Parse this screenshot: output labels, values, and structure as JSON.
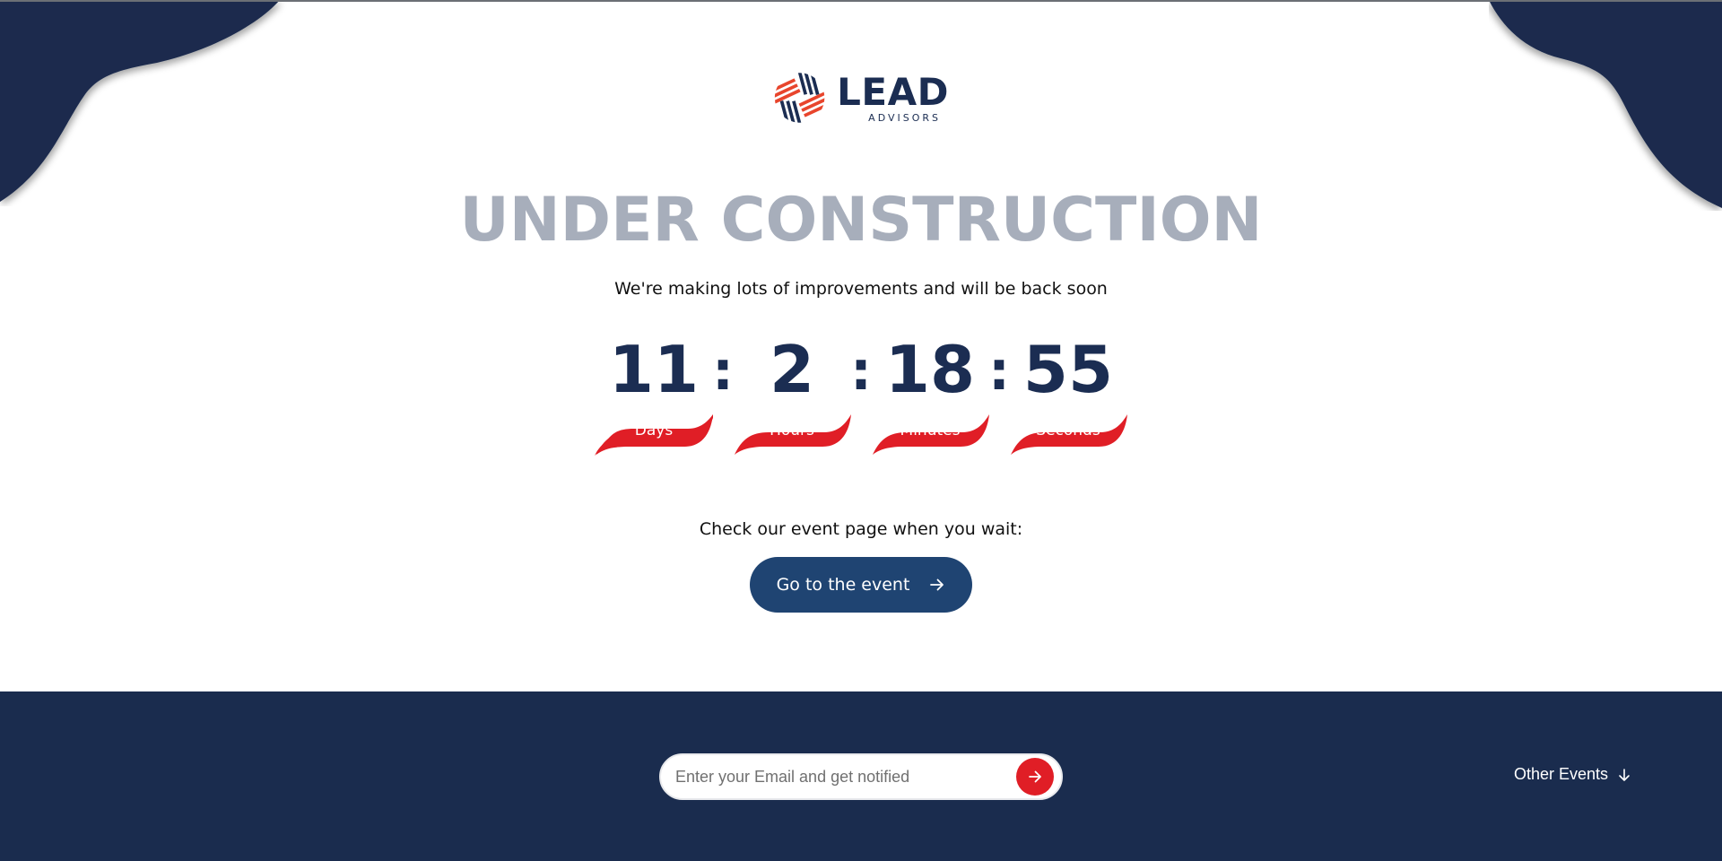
{
  "brand": {
    "name": "LEAD",
    "tagline": "ADVISORS",
    "colors": {
      "navy": "#1b2d52",
      "red": "#e01e26",
      "button_blue": "#1f4472",
      "headline_gray": "#a7aebb"
    }
  },
  "hero": {
    "headline": "UNDER CONSTRUCTION",
    "subheadline": "We're making lots of improvements and will be back soon"
  },
  "countdown": {
    "separator": ":",
    "units": [
      {
        "value": "11",
        "label": "Days"
      },
      {
        "value": "2",
        "label": "Hours"
      },
      {
        "value": "18",
        "label": "Minutes"
      },
      {
        "value": "55",
        "label": "Seconds"
      }
    ]
  },
  "event": {
    "prompt": "Check our event page when you wait:",
    "button_label": "Go to the event",
    "button_icon": "arrow-right-icon"
  },
  "footer": {
    "email_placeholder": "Enter your Email and get notified",
    "email_value": "",
    "submit_icon": "arrow-right-icon",
    "other_events_label": "Other Events",
    "other_events_icon": "arrow-down-icon"
  }
}
